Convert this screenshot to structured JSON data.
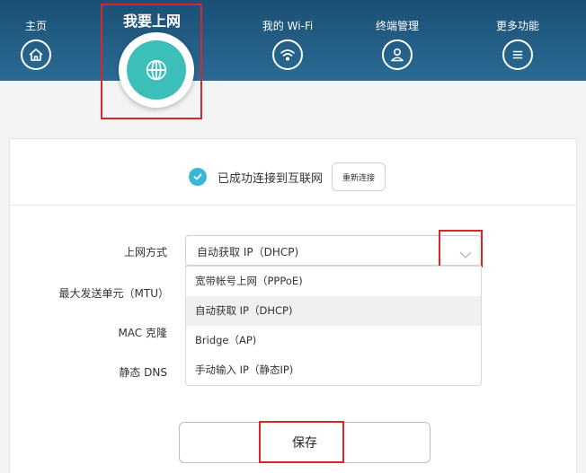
{
  "nav": {
    "items": [
      {
        "label": "主页",
        "icon": "home-icon"
      },
      {
        "label": "我要上网",
        "icon": "globe-icon",
        "active": true
      },
      {
        "label": "我的 Wi-Fi",
        "icon": "wifi-icon"
      },
      {
        "label": "终端管理",
        "icon": "user-icon"
      },
      {
        "label": "更多功能",
        "icon": "menu-icon"
      }
    ]
  },
  "status": {
    "text": "已成功连接到互联网",
    "reconnect_label": "重新连接"
  },
  "form": {
    "mode_label": "上网方式",
    "mtu_label": "最大发送单元（MTU）",
    "mac_label": "MAC 克隆",
    "dns_label": "静态 DNS",
    "selected_value": "自动获取 IP（DHCP)",
    "options": [
      "宽带帐号上网（PPPoE)",
      "自动获取 IP（DHCP)",
      "Bridge（AP)",
      "手动输入 IP（静态IP)"
    ],
    "selected_index": 1
  },
  "save_label": "保存",
  "colors": {
    "header": "#2a6b95",
    "accent": "#3cbfb8",
    "check": "#3cb6d8",
    "highlight": "#d9262b"
  }
}
